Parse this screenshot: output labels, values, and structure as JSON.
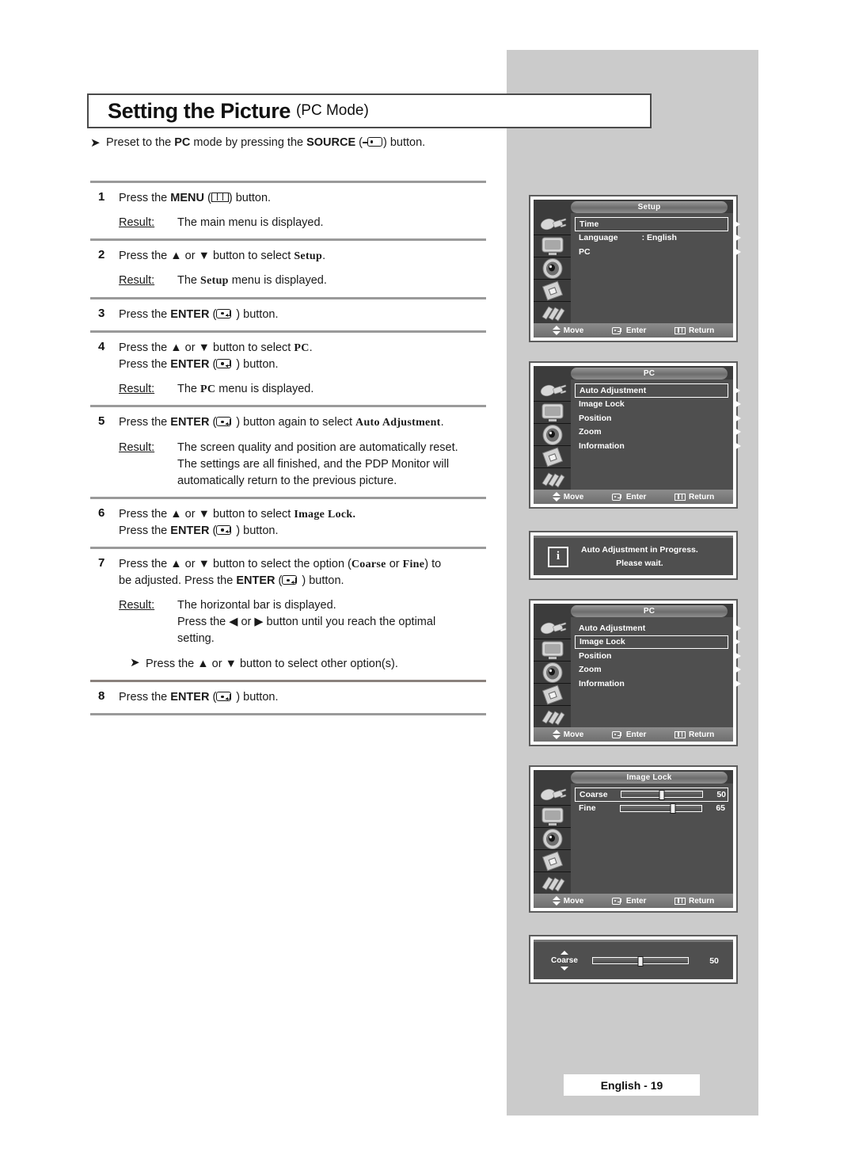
{
  "page": {
    "title_main": "Setting the Picture",
    "title_sub": "(PC Mode)",
    "footer_badge": "English - 19"
  },
  "intro_note": {
    "pre": "Preset to the ",
    "bold1": "PC",
    "mid": " mode by pressing the ",
    "bold2": "SOURCE",
    "post": ") button.",
    "paren_open": " ("
  },
  "steps": [
    {
      "num": "1",
      "lines": [
        {
          "parts": [
            {
              "t": "Press the ",
              "s": "n"
            },
            {
              "t": "MENU",
              "s": "b"
            },
            {
              "t": " (",
              "s": "n"
            },
            {
              "t": "__MENU_GLYPH__",
              "s": "g"
            },
            {
              "t": ") button.",
              "s": "n"
            }
          ]
        }
      ],
      "result_label": "Result:",
      "result_lines": [
        "The main menu is displayed."
      ]
    },
    {
      "num": "2",
      "lines": [
        {
          "parts": [
            {
              "t": "Press the ▲ or ▼ button to select ",
              "s": "n"
            },
            {
              "t": "Setup",
              "s": "m"
            },
            {
              "t": ".",
              "s": "n"
            }
          ]
        }
      ],
      "result_label": "Result:",
      "result_lines": [
        "__R2__"
      ]
    },
    {
      "num": "3",
      "lines": [
        {
          "parts": [
            {
              "t": "Press the ",
              "s": "n"
            },
            {
              "t": "ENTER",
              "s": "b"
            },
            {
              "t": " (",
              "s": "n"
            },
            {
              "t": "__ENTER_GLYPH__",
              "s": "g"
            },
            {
              "t": ") button.",
              "s": "n"
            }
          ]
        }
      ]
    },
    {
      "num": "4",
      "lines": [
        {
          "parts": [
            {
              "t": "Press the ▲ or ▼ button to select ",
              "s": "n"
            },
            {
              "t": "PC",
              "s": "m"
            },
            {
              "t": ".",
              "s": "n"
            }
          ]
        },
        {
          "parts": [
            {
              "t": "Press the ",
              "s": "n"
            },
            {
              "t": "ENTER",
              "s": "b"
            },
            {
              "t": " (",
              "s": "n"
            },
            {
              "t": "__ENTER_GLYPH__",
              "s": "g"
            },
            {
              "t": ") button.",
              "s": "n"
            }
          ]
        }
      ],
      "result_label": "Result:",
      "result_lines": [
        "__R4__"
      ]
    },
    {
      "num": "5",
      "lines": [
        {
          "parts": [
            {
              "t": "Press the ",
              "s": "n"
            },
            {
              "t": "ENTER",
              "s": "b"
            },
            {
              "t": " (",
              "s": "n"
            },
            {
              "t": "__ENTER_GLYPH__",
              "s": "g"
            },
            {
              "t": ") button again to select ",
              "s": "n"
            },
            {
              "t": "Auto Adjustment",
              "s": "m"
            },
            {
              "t": ".",
              "s": "n"
            }
          ]
        }
      ],
      "result_label": "Result:",
      "result_lines": [
        "The screen quality and position are automatically reset.",
        "The settings are all finished, and the PDP Monitor will",
        "automatically return to the previous picture."
      ]
    },
    {
      "num": "6",
      "lines": [
        {
          "parts": [
            {
              "t": "Press the ▲ or ▼ button to select ",
              "s": "n"
            },
            {
              "t": "Image Lock.",
              "s": "m"
            }
          ]
        },
        {
          "parts": [
            {
              "t": "Press the ",
              "s": "n"
            },
            {
              "t": "ENTER",
              "s": "b"
            },
            {
              "t": " (",
              "s": "n"
            },
            {
              "t": "__ENTER_GLYPH__",
              "s": "g"
            },
            {
              "t": ") button.",
              "s": "n"
            }
          ]
        }
      ]
    },
    {
      "num": "7",
      "lines": [
        {
          "parts": [
            {
              "t": "Press the ▲ or ▼ button to select the option (",
              "s": "n"
            },
            {
              "t": "Coarse",
              "s": "m"
            },
            {
              "t": " or ",
              "s": "n"
            },
            {
              "t": "Fine",
              "s": "m"
            },
            {
              "t": ") to",
              "s": "n"
            }
          ]
        },
        {
          "parts": [
            {
              "t": "be adjusted. Press the ",
              "s": "n"
            },
            {
              "t": "ENTER",
              "s": "b"
            },
            {
              "t": " (",
              "s": "n"
            },
            {
              "t": "__ENTER_GLYPH__",
              "s": "g"
            },
            {
              "t": ") button.",
              "s": "n"
            }
          ]
        }
      ],
      "result_label": "Result:",
      "result_lines": [
        "The horizontal bar is displayed.",
        "Press the ◀ or ▶ button until you reach the optimal",
        "setting."
      ],
      "sub_note": "Press the ▲ or ▼ button to select other option(s)."
    },
    {
      "num": "8",
      "lines": [
        {
          "parts": [
            {
              "t": "Press the ",
              "s": "n"
            },
            {
              "t": "ENTER",
              "s": "b"
            },
            {
              "t": " (",
              "s": "n"
            },
            {
              "t": "__ENTER_GLYPH__",
              "s": "g"
            },
            {
              "t": ") button.",
              "s": "n"
            }
          ]
        }
      ]
    }
  ],
  "step2_result": {
    "pre": "The ",
    "mono": "Setup",
    "post": " menu is displayed."
  },
  "step4_result": {
    "pre": "The ",
    "mono": "PC",
    "post": "  menu is displayed."
  },
  "osd_footer": {
    "move": "Move",
    "enter": "Enter",
    "return": "Return"
  },
  "osd_panels": {
    "setup": {
      "title": "Setup",
      "rows": [
        {
          "label": "Time",
          "value": "",
          "selected": true
        },
        {
          "label": "Language",
          "value": ": English",
          "selected": false
        },
        {
          "label": "PC",
          "value": "",
          "selected": false
        }
      ]
    },
    "pc_auto": {
      "title": "PC",
      "rows": [
        {
          "label": "Auto Adjustment",
          "value": "",
          "selected": true
        },
        {
          "label": "Image Lock",
          "value": "",
          "selected": false
        },
        {
          "label": "Position",
          "value": "",
          "selected": false
        },
        {
          "label": "Zoom",
          "value": "",
          "selected": false
        },
        {
          "label": "Information",
          "value": "",
          "selected": false
        }
      ]
    },
    "progress_msg": {
      "icon": "i",
      "line1": "Auto Adjustment in Progress.",
      "line2": "Please wait."
    },
    "pc_imagelock": {
      "title": "PC",
      "rows": [
        {
          "label": "Auto Adjustment",
          "value": "",
          "selected": false
        },
        {
          "label": "Image Lock",
          "value": "",
          "selected": true
        },
        {
          "label": "Position",
          "value": "",
          "selected": false
        },
        {
          "label": "Zoom",
          "value": "",
          "selected": false
        },
        {
          "label": "Information",
          "value": "",
          "selected": false
        }
      ]
    },
    "image_lock": {
      "title": "Image Lock",
      "sliders": [
        {
          "label": "Coarse",
          "value": "50",
          "percent": 50,
          "selected": true
        },
        {
          "label": "Fine",
          "value": "65",
          "percent": 65,
          "selected": false
        }
      ]
    },
    "coarse_bar": {
      "label": "Coarse",
      "value": "50",
      "percent": 50
    }
  },
  "sidebar_icons": [
    "input-plug-icon",
    "monitor-icon",
    "speaker-icon",
    "chip-setup-icon",
    "features-icon"
  ]
}
